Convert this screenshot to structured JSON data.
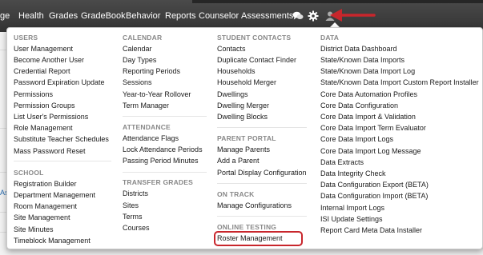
{
  "navbar": {
    "items": [
      "ge",
      "Health",
      "Grades",
      "GradeBook",
      "Behavior",
      "Reports",
      "Counselor",
      "Assessments"
    ],
    "icons": [
      "chat-bubbles-icon",
      "gear-icon",
      "user-icon"
    ]
  },
  "background": {
    "left_fragment": "As"
  },
  "menu": {
    "users": {
      "heading": "USERS",
      "items": [
        "User Management",
        "Become Another User",
        "Credential Report",
        "Password Expiration Update",
        "Permissions",
        "Permission Groups",
        "List User's Permissions",
        "Role Management",
        "Substitute Teacher Schedules",
        "Mass Password Reset"
      ]
    },
    "school": {
      "heading": "SCHOOL",
      "items": [
        "Registration Builder",
        "Department Management",
        "Room Management",
        "Site Management",
        "Site Minutes",
        "Timeblock Management"
      ]
    },
    "calendar": {
      "heading": "CALENDAR",
      "items": [
        "Calendar",
        "Day Types",
        "Reporting Periods",
        "Sessions",
        "Year-to-Year Rollover",
        "Term Manager"
      ]
    },
    "attendance": {
      "heading": "ATTENDANCE",
      "items": [
        "Attendance Flags",
        "Lock Attendance Periods",
        "Passing Period Minutes"
      ]
    },
    "transfer_grades": {
      "heading": "TRANSFER GRADES",
      "items": [
        "Districts",
        "Sites",
        "Terms",
        "Courses"
      ]
    },
    "student_contacts": {
      "heading": "STUDENT CONTACTS",
      "items": [
        "Contacts",
        "Duplicate Contact Finder",
        "Households",
        "Household Merger",
        "Dwellings",
        "Dwelling Merger",
        "Dwelling Blocks"
      ]
    },
    "parent_portal": {
      "heading": "PARENT PORTAL",
      "items": [
        "Manage Parents",
        "Add a Parent",
        "Portal Display Configuration"
      ]
    },
    "on_track": {
      "heading": "ON TRACK",
      "items": [
        "Manage Configurations"
      ]
    },
    "online_testing": {
      "heading": "ONLINE TESTING",
      "items": [
        "Roster Management"
      ]
    },
    "data": {
      "heading": "DATA",
      "items": [
        "District Data Dashboard",
        "State/Known Data Imports",
        "State/Known Data Import Log",
        "State/Known Data Import Custom Report Installer",
        "Core Data Automation Profiles",
        "Core Data Configuration",
        "Core Data Import & Validation",
        "Core Data Import Term Evaluator",
        "Core Data Import Logs",
        "Core Data Import Log Message",
        "Data Extracts",
        "Data Integrity Check",
        "Data Configuration Export (BETA)",
        "Data Configuration Import (BETA)",
        "Internal Import Logs",
        "ISI Update Settings",
        "Report Card Meta Data Installer"
      ]
    }
  },
  "annotation": {
    "highlight_color": "#c8262c",
    "arrow_color": "#c8262c"
  }
}
